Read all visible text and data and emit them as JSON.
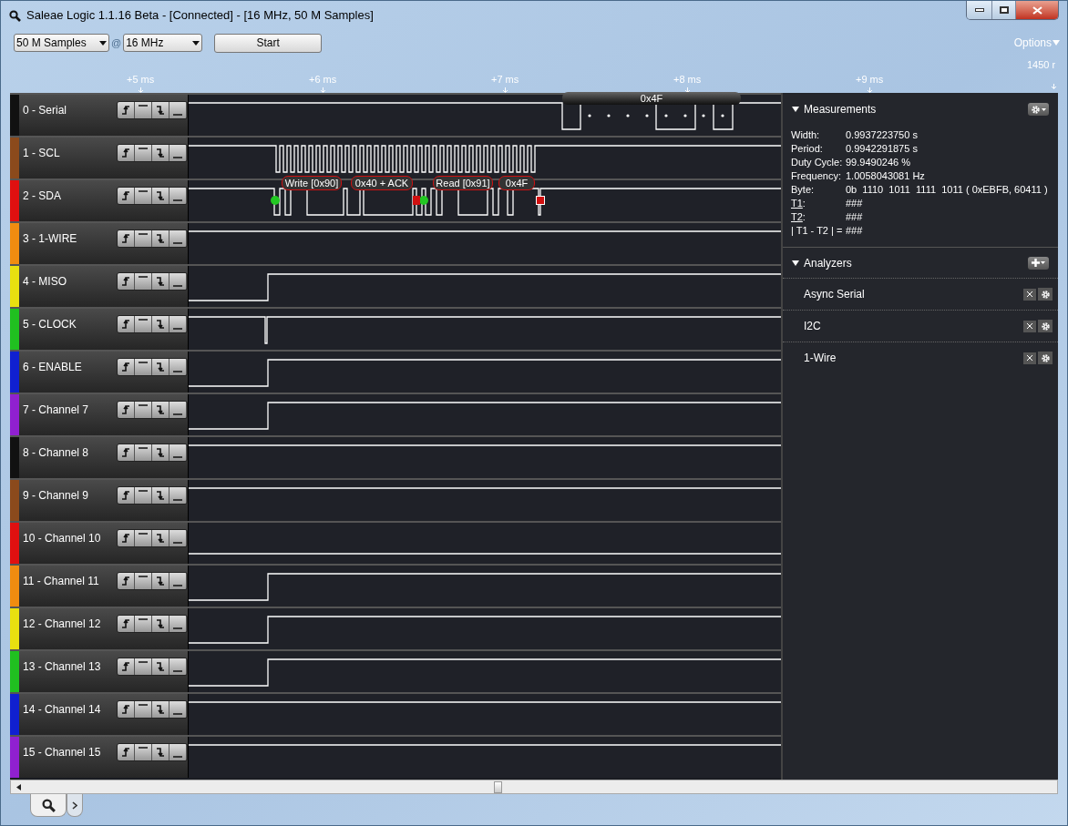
{
  "window": {
    "title": "Saleae Logic 1.1.16 Beta - [Connected] - [16 MHz, 50 M Samples]"
  },
  "toolbar": {
    "samples": "50 M Samples",
    "at": "@",
    "rate": "16 MHz",
    "start": "Start",
    "options": "Options"
  },
  "ruler": {
    "labels": [
      "+5 ms",
      "+6 ms",
      "+7 ms",
      "+8 ms",
      "+9 ms",
      "1450 r"
    ]
  },
  "channels": [
    {
      "name": "0 - Serial",
      "color": "#111111",
      "kind": "serial",
      "bubbles": [
        "0x4F"
      ]
    },
    {
      "name": "1 - SCL",
      "color": "#8b4a1c",
      "kind": "clock"
    },
    {
      "name": "2 - SDA",
      "color": "#e01010",
      "kind": "i2c",
      "bubbles": [
        "Write [0x90]",
        "0x40 + ACK",
        "Read [0x91]",
        "0x4F"
      ]
    },
    {
      "name": "3 - 1-WIRE",
      "color": "#f08c10",
      "kind": "high"
    },
    {
      "name": "4 - MISO",
      "color": "#e8e010",
      "kind": "rise"
    },
    {
      "name": "5 - CLOCK",
      "color": "#20c020",
      "kind": "dip"
    },
    {
      "name": "6 - ENABLE",
      "color": "#1020d0",
      "kind": "rise"
    },
    {
      "name": "7 - Channel 7",
      "color": "#9020d0",
      "kind": "rise"
    },
    {
      "name": "8 - Channel 8",
      "color": "#111111",
      "kind": "high"
    },
    {
      "name": "9 - Channel 9",
      "color": "#8b4a1c",
      "kind": "high"
    },
    {
      "name": "10 - Channel 10",
      "color": "#e01010",
      "kind": "low"
    },
    {
      "name": "11 - Channel 11",
      "color": "#f08c10",
      "kind": "rise"
    },
    {
      "name": "12 - Channel 12",
      "color": "#e8e010",
      "kind": "rise"
    },
    {
      "name": "13 - Channel 13",
      "color": "#20c020",
      "kind": "rise"
    },
    {
      "name": "14 - Channel 14",
      "color": "#1020d0",
      "kind": "high"
    },
    {
      "name": "15 - Channel 15",
      "color": "#9020d0",
      "kind": "high"
    }
  ],
  "measurements": {
    "title": "Measurements",
    "expanded": true,
    "rows": [
      {
        "label": "Width:",
        "value": "0.9937223750 s"
      },
      {
        "label": "Period:",
        "value": "0.9942291875 s"
      },
      {
        "label": "Duty Cycle:",
        "value": "99.9490246 %"
      },
      {
        "label": "Frequency:",
        "value": "1.0058043081 Hz"
      },
      {
        "label": "Byte:",
        "value": "0b  1110  1011  1111  1011 ( 0xEBFB, 60411 )"
      },
      {
        "label": "T1",
        "suffix": ":",
        "value": "###",
        "kind": "link"
      },
      {
        "label": "T2",
        "suffix": ":",
        "value": "###",
        "kind": "link"
      },
      {
        "label": "| T1 - T2 | =",
        "value": "###"
      }
    ]
  },
  "analyzers": {
    "title": "Analyzers",
    "expanded": true,
    "items": [
      "Async Serial",
      "I2C",
      "1-Wire"
    ]
  },
  "tabs": [
    {
      "kind": "search",
      "selected": true
    },
    {
      "kind": "next",
      "selected": false
    }
  ]
}
